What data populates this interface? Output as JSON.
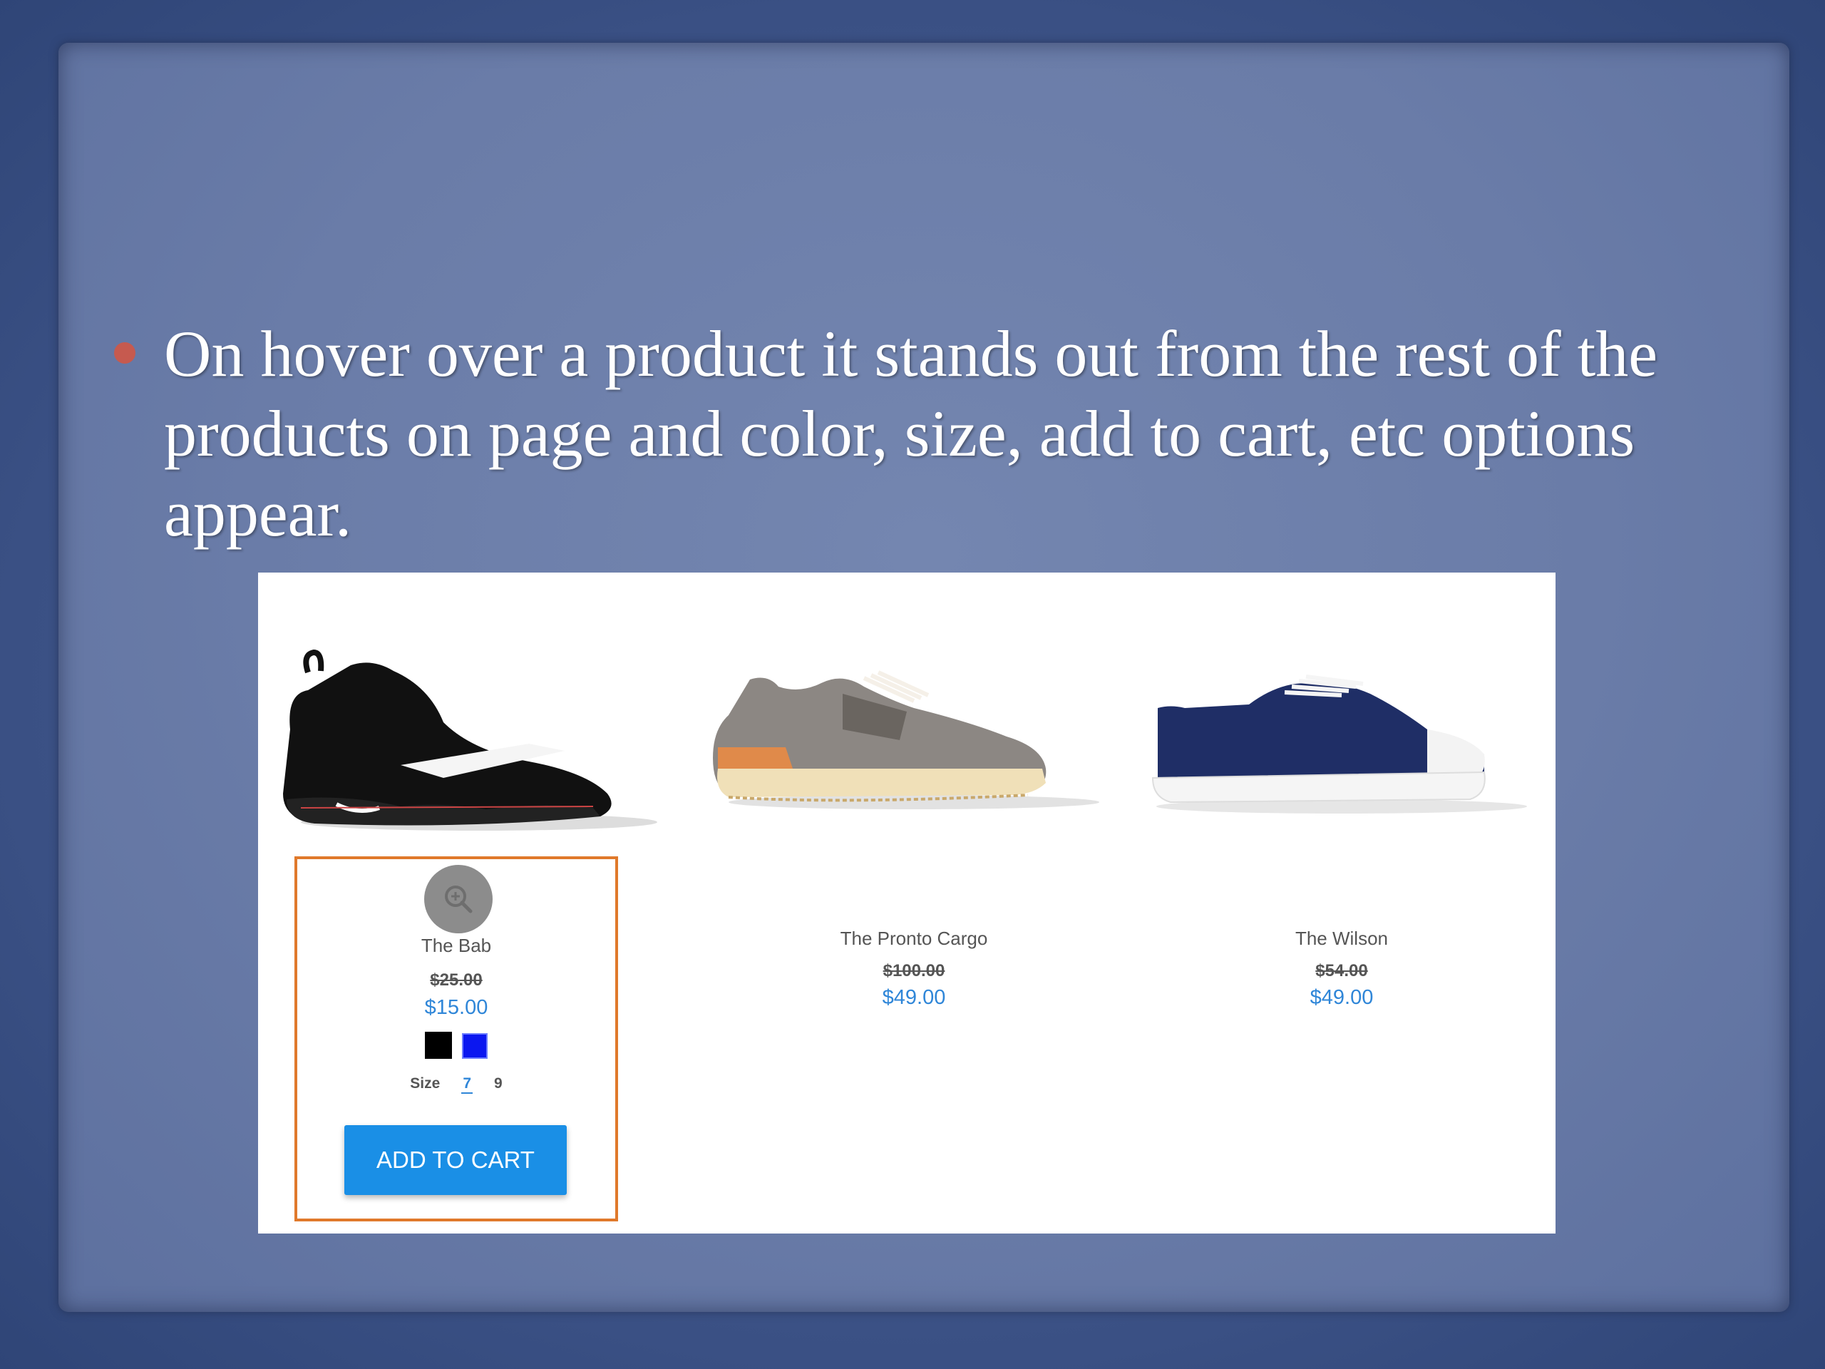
{
  "slide": {
    "bullet": "On hover over a product it stands out from the rest of the products on page and color, size, add to cart, etc options appear."
  },
  "products": [
    {
      "name": "The Bab",
      "old_price": "$25.00",
      "price": "$15.00",
      "colors": [
        "#000000",
        "#0b17f0"
      ],
      "size_label": "Size",
      "sizes": [
        "7",
        "9"
      ],
      "selected_size": "7",
      "add_to_cart": "ADD TO CART",
      "zoom_icon": "zoom-in-icon"
    },
    {
      "name": "The Pronto Cargo",
      "old_price": "$100.00",
      "price": "$49.00"
    },
    {
      "name": "The Wilson",
      "old_price": "$54.00",
      "price": "$49.00"
    }
  ],
  "colors": {
    "hover_border": "#e0792b",
    "button": "#1a8fe6",
    "price": "#2f86d8",
    "bullet": "#c65a4f"
  }
}
